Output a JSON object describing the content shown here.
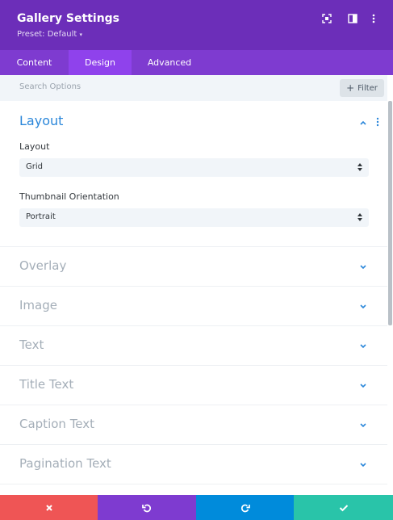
{
  "header": {
    "title": "Gallery Settings",
    "preset": "Preset: Default",
    "icons": [
      "fullscreen-icon",
      "split-view-icon",
      "more-options-icon"
    ]
  },
  "tabs": [
    {
      "label": "Content",
      "active": false
    },
    {
      "label": "Design",
      "active": true
    },
    {
      "label": "Advanced",
      "active": false
    }
  ],
  "search": {
    "placeholder": "Search Options",
    "filter_label": "Filter"
  },
  "sections": {
    "layout": {
      "title": "Layout",
      "fields": [
        {
          "label": "Layout",
          "value": "Grid"
        },
        {
          "label": "Thumbnail Orientation",
          "value": "Portrait"
        }
      ]
    },
    "collapsed": [
      "Overlay",
      "Image",
      "Text",
      "Title Text",
      "Caption Text",
      "Pagination Text"
    ]
  },
  "footer": {
    "buttons": [
      "discard",
      "undo",
      "redo",
      "save"
    ]
  },
  "colors": {
    "header": "#6c2eb9",
    "tabs": "#7e3bd0",
    "active_tab": "#8f42ec",
    "accent_blue": "#2b87da",
    "discard": "#ef5555",
    "undo": "#7e3bd0",
    "redo": "#008bdb",
    "save": "#29c4a9"
  }
}
